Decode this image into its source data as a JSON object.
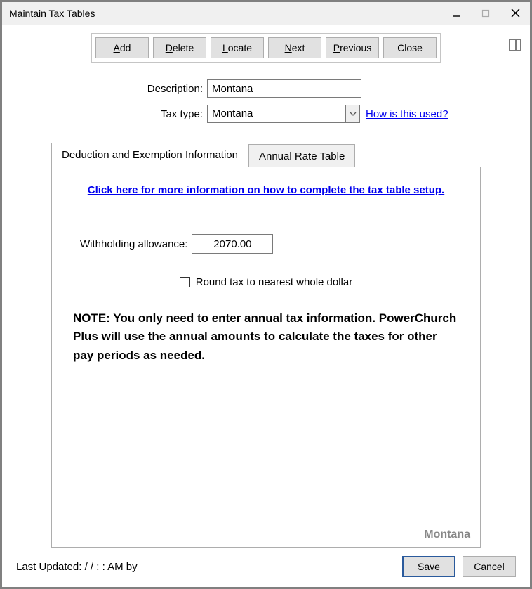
{
  "window": {
    "title": "Maintain Tax Tables"
  },
  "toolbar": {
    "add": "Add",
    "delete": "Delete",
    "locate": "Locate",
    "next": "Next",
    "previous": "Previous",
    "close": "Close"
  },
  "form": {
    "description_label": "Description:",
    "description_value": "Montana",
    "taxtype_label": "Tax type:",
    "taxtype_value": "Montana",
    "how_used_link": "How is this used?"
  },
  "tabs": {
    "deduction": "Deduction and Exemption Information",
    "annual": "Annual Rate Table"
  },
  "panel": {
    "setup_link": "Click here for more information on how to complete the tax table setup.",
    "withholding_label": "Withholding allowance:",
    "withholding_value": "2070.00",
    "round_label": "Round tax to nearest whole dollar",
    "note": "NOTE: You only need to enter annual tax information. PowerChurch Plus will use the annual amounts to calculate the taxes for other pay periods as needed.",
    "watermark": "Montana"
  },
  "footer": {
    "last_updated": "Last Updated:   /  /        :   :    AM by",
    "save": "Save",
    "cancel": "Cancel"
  }
}
